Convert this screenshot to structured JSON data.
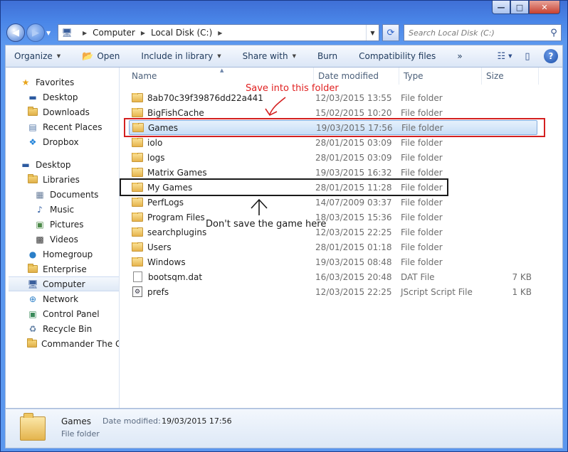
{
  "caption": {
    "minimize": "—",
    "maximize": "□",
    "close": "✕"
  },
  "address": {
    "segments": [
      "Computer",
      "Local Disk (C:)"
    ],
    "search_placeholder": "Search Local Disk (C:)"
  },
  "toolbar": {
    "organize": "Organize",
    "open": "Open",
    "include_in_library": "Include in library",
    "share_with": "Share with",
    "burn": "Burn",
    "compatibility_files": "Compatibility files",
    "more": "»"
  },
  "nav": {
    "favorites": "Favorites",
    "desktop_fav": "Desktop",
    "downloads": "Downloads",
    "recent_places": "Recent Places",
    "dropbox": "Dropbox",
    "desktop": "Desktop",
    "libraries": "Libraries",
    "documents": "Documents",
    "music": "Music",
    "pictures": "Pictures",
    "videos": "Videos",
    "homegroup": "Homegroup",
    "enterprise": "Enterprise",
    "computer": "Computer",
    "network": "Network",
    "control_panel": "Control Panel",
    "recycle_bin": "Recycle Bin",
    "commander": "Commander The Gr"
  },
  "columns": {
    "name": "Name",
    "date": "Date modified",
    "type": "Type",
    "size": "Size"
  },
  "files": [
    {
      "name": "8ab70c39f39876dd22a441",
      "date": "12/03/2015 13:55",
      "type": "File folder",
      "size": ""
    },
    {
      "name": "BigFishCache",
      "date": "15/02/2015 10:20",
      "type": "File folder",
      "size": ""
    },
    {
      "name": "Games",
      "date": "19/03/2015 17:56",
      "type": "File folder",
      "size": ""
    },
    {
      "name": "iolo",
      "date": "28/01/2015 03:09",
      "type": "File folder",
      "size": ""
    },
    {
      "name": "logs",
      "date": "28/01/2015 03:09",
      "type": "File folder",
      "size": ""
    },
    {
      "name": "Matrix Games",
      "date": "19/03/2015 16:32",
      "type": "File folder",
      "size": ""
    },
    {
      "name": "My Games",
      "date": "28/01/2015 11:28",
      "type": "File folder",
      "size": ""
    },
    {
      "name": "PerfLogs",
      "date": "14/07/2009 03:37",
      "type": "File folder",
      "size": ""
    },
    {
      "name": "Program Files",
      "date": "18/03/2015 15:36",
      "type": "File folder",
      "size": ""
    },
    {
      "name": "searchplugins",
      "date": "12/03/2015 22:25",
      "type": "File folder",
      "size": ""
    },
    {
      "name": "Users",
      "date": "28/01/2015 01:18",
      "type": "File folder",
      "size": ""
    },
    {
      "name": "Windows",
      "date": "19/03/2015 08:48",
      "type": "File folder",
      "size": ""
    },
    {
      "name": "bootsqm.dat",
      "date": "16/03/2015 20:48",
      "type": "DAT File",
      "size": "7 KB"
    },
    {
      "name": "prefs",
      "date": "12/03/2015 22:25",
      "type": "JScript Script File",
      "size": "1 KB"
    }
  ],
  "annotations": {
    "save_here": "Save into this folder",
    "dont_save": "Don't save the game here",
    "highlight_color": "#d42020"
  },
  "details": {
    "name": "Games",
    "modified_label": "Date modified:",
    "modified_value": "19/03/2015 17:56",
    "type": "File folder"
  }
}
